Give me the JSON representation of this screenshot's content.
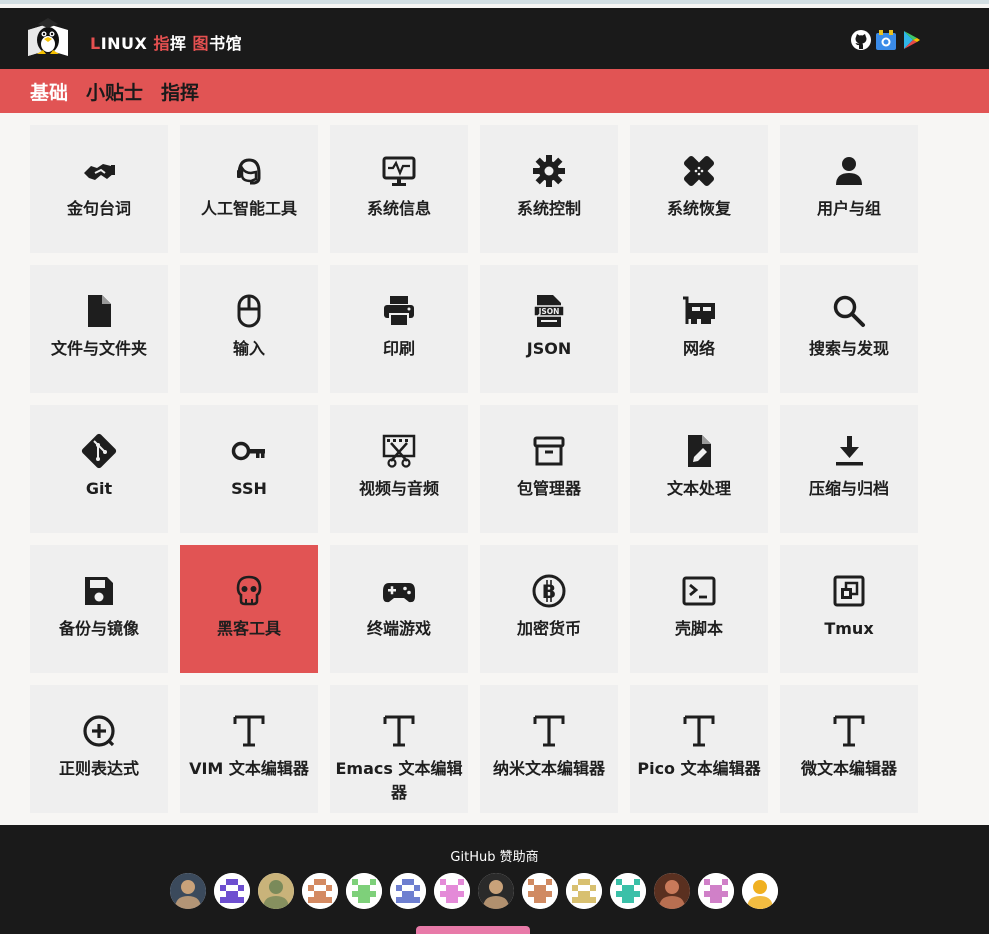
{
  "header": {
    "brand_parts": [
      {
        "text": "L",
        "color": "#e55050"
      },
      {
        "text": "INUX ",
        "color": "#ffffff"
      },
      {
        "text": "指",
        "color": "#e55050"
      },
      {
        "text": "挥 ",
        "color": "#ffffff"
      },
      {
        "text": "图",
        "color": "#e55050"
      },
      {
        "text": "书馆",
        "color": "#ffffff"
      }
    ],
    "icons": [
      "github-icon",
      "chrome-store-icon",
      "google-play-icon"
    ]
  },
  "categories": [
    {
      "label": "基础",
      "active": true
    },
    {
      "label": "小贴士",
      "active": false
    },
    {
      "label": "指挥",
      "active": false
    }
  ],
  "tiles": [
    {
      "label": "金句台词",
      "icon": "handshake-icon"
    },
    {
      "label": "人工智能工具",
      "icon": "headset-icon"
    },
    {
      "label": "系统信息",
      "icon": "monitor-icon"
    },
    {
      "label": "系统控制",
      "icon": "gear-icon"
    },
    {
      "label": "系统恢复",
      "icon": "bandage-icon"
    },
    {
      "label": "用户与组",
      "icon": "user-icon"
    },
    {
      "label": "文件与文件夹",
      "icon": "file-icon"
    },
    {
      "label": "输入",
      "icon": "mouse-icon"
    },
    {
      "label": "印刷",
      "icon": "printer-icon"
    },
    {
      "label": "JSON",
      "icon": "json-file-icon"
    },
    {
      "label": "网络",
      "icon": "network-card-icon"
    },
    {
      "label": "搜索与发现",
      "icon": "search-icon"
    },
    {
      "label": "Git",
      "icon": "git-icon"
    },
    {
      "label": "SSH",
      "icon": "key-icon"
    },
    {
      "label": "视频与音频",
      "icon": "film-scissors-icon"
    },
    {
      "label": "包管理器",
      "icon": "box-icon"
    },
    {
      "label": "文本处理",
      "icon": "file-edit-icon"
    },
    {
      "label": "压缩与归档",
      "icon": "download-icon"
    },
    {
      "label": "备份与镜像",
      "icon": "floppy-disk-icon"
    },
    {
      "label": "黑客工具",
      "icon": "skull-icon",
      "active": true
    },
    {
      "label": "终端游戏",
      "icon": "gamepad-icon"
    },
    {
      "label": "加密货币",
      "icon": "bitcoin-icon"
    },
    {
      "label": "壳脚本",
      "icon": "terminal-icon"
    },
    {
      "label": "Tmux",
      "icon": "window-restore-icon"
    },
    {
      "label": "正则表达式",
      "icon": "circle-plus-icon"
    },
    {
      "label": "VIM 文本编辑器",
      "icon": "text-t-icon"
    },
    {
      "label": "Emacs 文本编辑器",
      "icon": "text-t-icon"
    },
    {
      "label": "纳米文本编辑器",
      "icon": "text-t-icon"
    },
    {
      "label": "Pico 文本编辑器",
      "icon": "text-t-icon"
    },
    {
      "label": "微文本编辑器",
      "icon": "text-t-icon"
    }
  ],
  "footer": {
    "sponsor_title": "GitHub 赞助商",
    "sponsors": [
      {
        "kind": "photo",
        "colors": [
          "#3b4a5c",
          "#c9a27a"
        ]
      },
      {
        "kind": "pixel",
        "colors": [
          "#ffffff",
          "#6e4fd0"
        ]
      },
      {
        "kind": "photo",
        "colors": [
          "#c9b37a",
          "#7a8a5a"
        ]
      },
      {
        "kind": "pixel",
        "colors": [
          "#ffffff",
          "#d48a62"
        ]
      },
      {
        "kind": "pixel",
        "colors": [
          "#ffffff",
          "#7ed07a"
        ]
      },
      {
        "kind": "pixel",
        "colors": [
          "#ffffff",
          "#6e7fd0"
        ]
      },
      {
        "kind": "pixel",
        "colors": [
          "#ffffff",
          "#e48ad8"
        ]
      },
      {
        "kind": "photo",
        "colors": [
          "#2a2a2a",
          "#c9a27a"
        ]
      },
      {
        "kind": "pixel",
        "colors": [
          "#ffffff",
          "#d08a62"
        ]
      },
      {
        "kind": "pixel",
        "colors": [
          "#ffffff",
          "#d8c070"
        ]
      },
      {
        "kind": "pixel",
        "colors": [
          "#ffffff",
          "#3ac0a8"
        ]
      },
      {
        "kind": "photo",
        "colors": [
          "#5a3020",
          "#c97a5a"
        ]
      },
      {
        "kind": "pixel",
        "colors": [
          "#ffffff",
          "#d080c8"
        ]
      },
      {
        "kind": "photo",
        "colors": [
          "#ffffff",
          "#f0b020"
        ]
      }
    ]
  },
  "colors": {
    "header_bg": "#1a1a1a",
    "accent": "#e15454",
    "tile_bg": "#efefef"
  }
}
